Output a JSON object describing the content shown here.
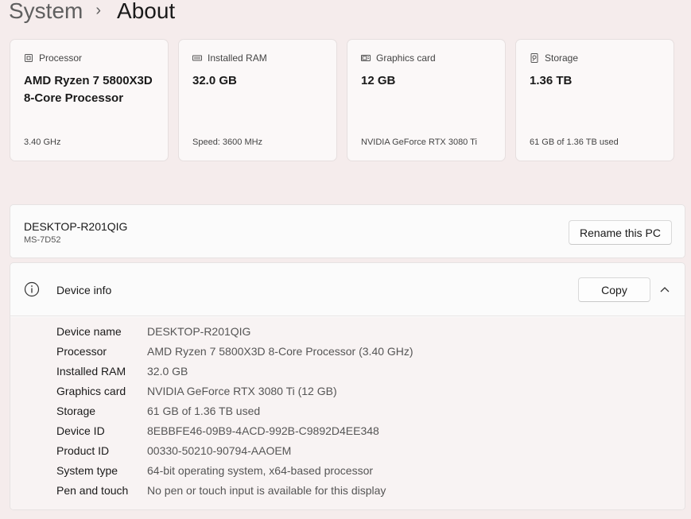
{
  "header": {
    "parent": "System",
    "current": "About"
  },
  "cards": [
    {
      "icon": "processor-icon",
      "label": "Processor",
      "value": "AMD Ryzen 7 5800X3D 8-Core Processor",
      "sub": "3.40 GHz"
    },
    {
      "icon": "ram-icon",
      "label": "Installed RAM",
      "value": "32.0 GB",
      "sub": "Speed: 3600 MHz"
    },
    {
      "icon": "graphics-card-icon",
      "label": "Graphics card",
      "value": "12 GB",
      "sub": "NVIDIA GeForce RTX 3080 Ti"
    },
    {
      "icon": "storage-icon",
      "label": "Storage",
      "value": "1.36 TB",
      "sub": "61 GB of 1.36 TB used"
    }
  ],
  "pc": {
    "name": "DESKTOP-R201QIG",
    "model": "MS-7D52",
    "rename_label": "Rename this PC"
  },
  "device_info": {
    "title": "Device info",
    "copy_label": "Copy",
    "rows": [
      {
        "label": "Device name",
        "value": "DESKTOP-R201QIG"
      },
      {
        "label": "Processor",
        "value": "AMD Ryzen 7 5800X3D 8-Core Processor (3.40 GHz)"
      },
      {
        "label": "Installed RAM",
        "value": "32.0 GB"
      },
      {
        "label": "Graphics card",
        "value": "NVIDIA GeForce RTX 3080 Ti (12 GB)"
      },
      {
        "label": "Storage",
        "value": "61 GB of 1.36 TB used"
      },
      {
        "label": "Device ID",
        "value": "8EBBFE46-09B9-4ACD-992B-C9892D4EE348"
      },
      {
        "label": "Product ID",
        "value": "00330-50210-90794-AAOEM"
      },
      {
        "label": "System type",
        "value": "64-bit operating system, x64-based processor"
      },
      {
        "label": "Pen and touch",
        "value": "No pen or touch input is available for this display"
      }
    ]
  }
}
